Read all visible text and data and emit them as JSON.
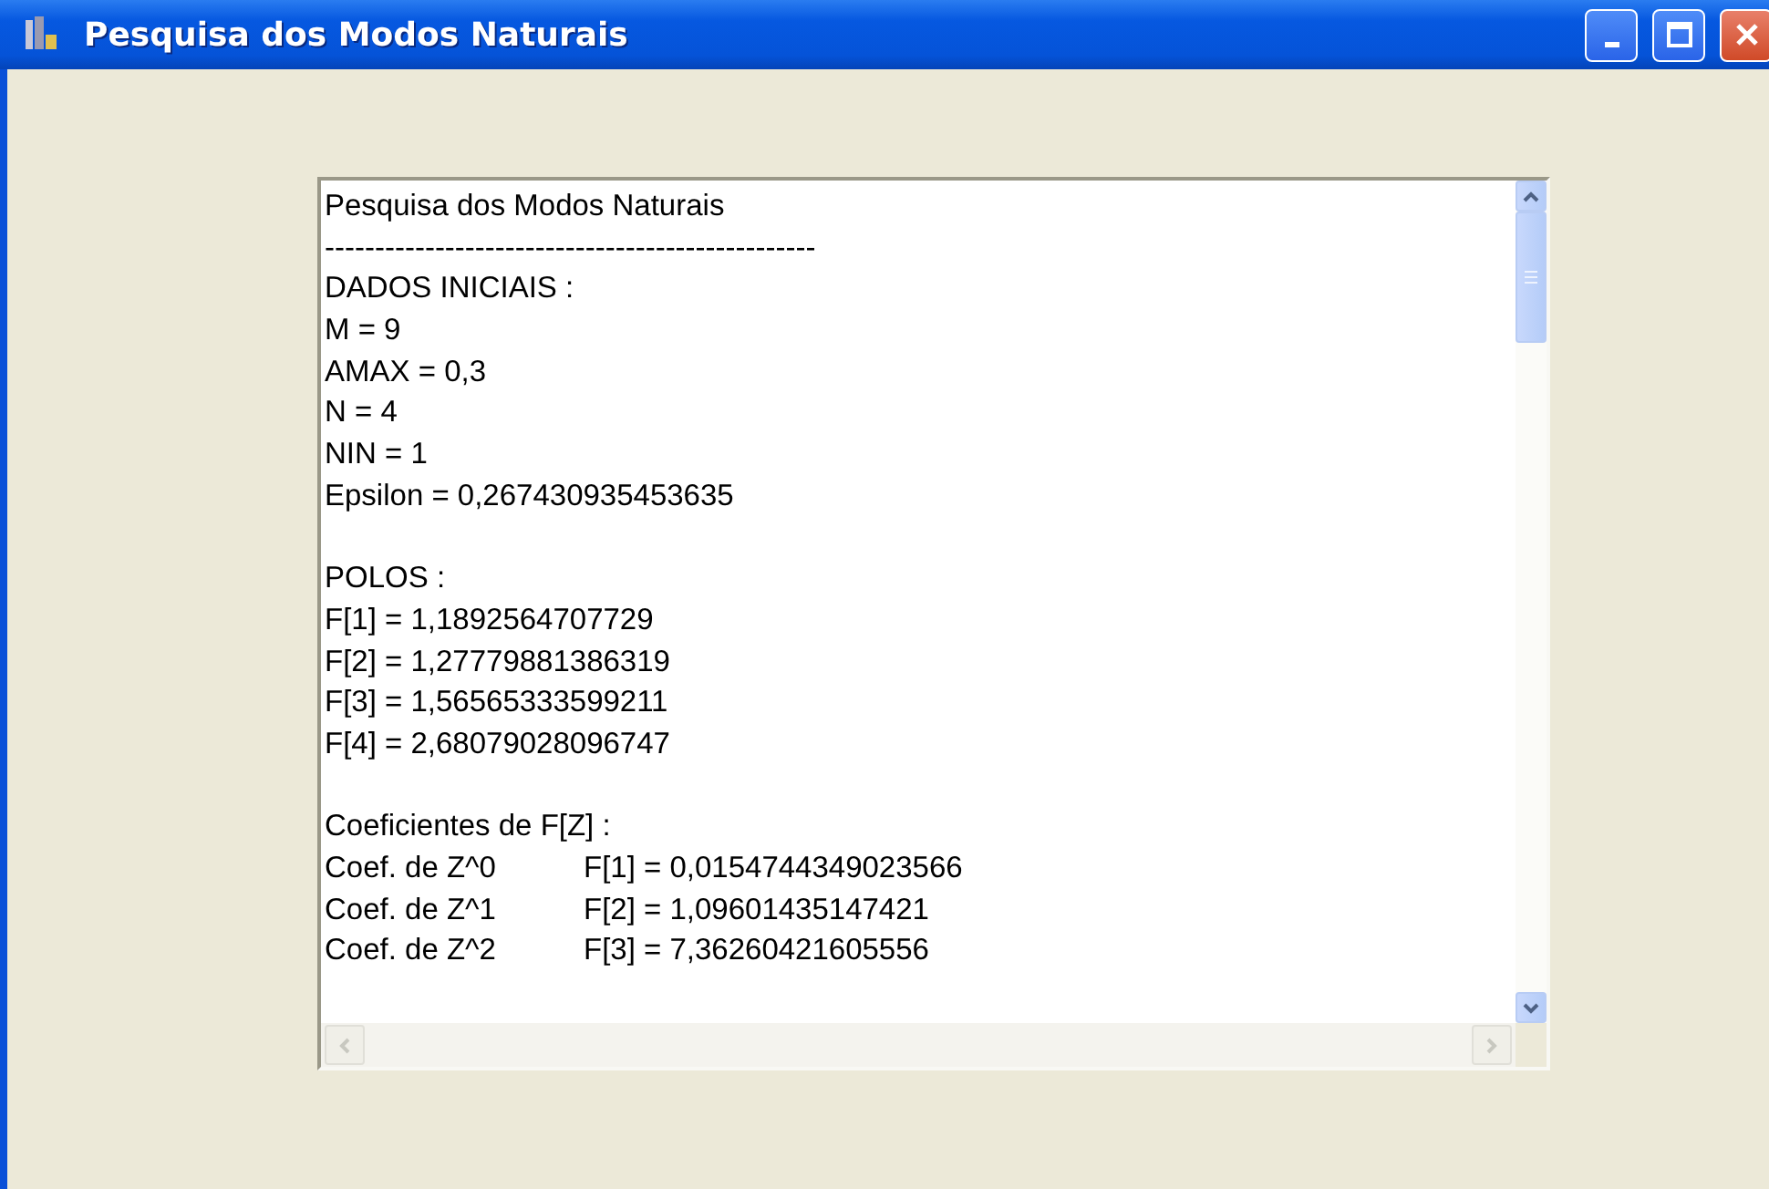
{
  "window": {
    "title": "Pesquisa dos Modos Naturais"
  },
  "output": {
    "lines": [
      {
        "kind": "text",
        "text": "Pesquisa dos Modos Naturais"
      },
      {
        "kind": "text",
        "text": "-------------------------------------------------"
      },
      {
        "kind": "text",
        "text": "DADOS INICIAIS :"
      },
      {
        "kind": "text",
        "text": "M = 9"
      },
      {
        "kind": "text",
        "text": "AMAX = 0,3"
      },
      {
        "kind": "text",
        "text": "N = 4"
      },
      {
        "kind": "text",
        "text": "NIN = 1"
      },
      {
        "kind": "text",
        "text": "Epsilon = 0,267430935453635"
      },
      {
        "kind": "blank"
      },
      {
        "kind": "text",
        "text": "POLOS :"
      },
      {
        "kind": "text",
        "text": "F[1] = 1,1892564707729"
      },
      {
        "kind": "text",
        "text": "F[2] = 1,27779881386319"
      },
      {
        "kind": "text",
        "text": "F[3] = 1,56565333599211"
      },
      {
        "kind": "text",
        "text": "F[4] = 2,68079028096747"
      },
      {
        "kind": "blank"
      },
      {
        "kind": "text",
        "text": "Coeficientes de F[Z] :"
      },
      {
        "kind": "pair",
        "label": "Coef. de Z^0",
        "value": "F[1] = 0,0154744349023566"
      },
      {
        "kind": "pair",
        "label": "Coef. de Z^1",
        "value": "F[2] = 1,09601435147421"
      },
      {
        "kind": "pair",
        "label": "Coef. de Z^2",
        "value": "F[3] = 7,36260421605556"
      }
    ]
  }
}
